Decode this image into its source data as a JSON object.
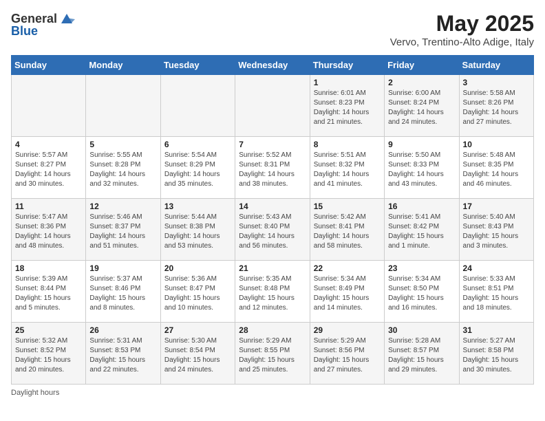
{
  "header": {
    "logo_general": "General",
    "logo_blue": "Blue",
    "month_year": "May 2025",
    "location": "Vervo, Trentino-Alto Adige, Italy"
  },
  "days_of_week": [
    "Sunday",
    "Monday",
    "Tuesday",
    "Wednesday",
    "Thursday",
    "Friday",
    "Saturday"
  ],
  "weeks": [
    [
      {
        "day": "",
        "info": ""
      },
      {
        "day": "",
        "info": ""
      },
      {
        "day": "",
        "info": ""
      },
      {
        "day": "",
        "info": ""
      },
      {
        "day": "1",
        "info": "Sunrise: 6:01 AM\nSunset: 8:23 PM\nDaylight: 14 hours\nand 21 minutes."
      },
      {
        "day": "2",
        "info": "Sunrise: 6:00 AM\nSunset: 8:24 PM\nDaylight: 14 hours\nand 24 minutes."
      },
      {
        "day": "3",
        "info": "Sunrise: 5:58 AM\nSunset: 8:26 PM\nDaylight: 14 hours\nand 27 minutes."
      }
    ],
    [
      {
        "day": "4",
        "info": "Sunrise: 5:57 AM\nSunset: 8:27 PM\nDaylight: 14 hours\nand 30 minutes."
      },
      {
        "day": "5",
        "info": "Sunrise: 5:55 AM\nSunset: 8:28 PM\nDaylight: 14 hours\nand 32 minutes."
      },
      {
        "day": "6",
        "info": "Sunrise: 5:54 AM\nSunset: 8:29 PM\nDaylight: 14 hours\nand 35 minutes."
      },
      {
        "day": "7",
        "info": "Sunrise: 5:52 AM\nSunset: 8:31 PM\nDaylight: 14 hours\nand 38 minutes."
      },
      {
        "day": "8",
        "info": "Sunrise: 5:51 AM\nSunset: 8:32 PM\nDaylight: 14 hours\nand 41 minutes."
      },
      {
        "day": "9",
        "info": "Sunrise: 5:50 AM\nSunset: 8:33 PM\nDaylight: 14 hours\nand 43 minutes."
      },
      {
        "day": "10",
        "info": "Sunrise: 5:48 AM\nSunset: 8:35 PM\nDaylight: 14 hours\nand 46 minutes."
      }
    ],
    [
      {
        "day": "11",
        "info": "Sunrise: 5:47 AM\nSunset: 8:36 PM\nDaylight: 14 hours\nand 48 minutes."
      },
      {
        "day": "12",
        "info": "Sunrise: 5:46 AM\nSunset: 8:37 PM\nDaylight: 14 hours\nand 51 minutes."
      },
      {
        "day": "13",
        "info": "Sunrise: 5:44 AM\nSunset: 8:38 PM\nDaylight: 14 hours\nand 53 minutes."
      },
      {
        "day": "14",
        "info": "Sunrise: 5:43 AM\nSunset: 8:40 PM\nDaylight: 14 hours\nand 56 minutes."
      },
      {
        "day": "15",
        "info": "Sunrise: 5:42 AM\nSunset: 8:41 PM\nDaylight: 14 hours\nand 58 minutes."
      },
      {
        "day": "16",
        "info": "Sunrise: 5:41 AM\nSunset: 8:42 PM\nDaylight: 15 hours\nand 1 minute."
      },
      {
        "day": "17",
        "info": "Sunrise: 5:40 AM\nSunset: 8:43 PM\nDaylight: 15 hours\nand 3 minutes."
      }
    ],
    [
      {
        "day": "18",
        "info": "Sunrise: 5:39 AM\nSunset: 8:44 PM\nDaylight: 15 hours\nand 5 minutes."
      },
      {
        "day": "19",
        "info": "Sunrise: 5:37 AM\nSunset: 8:46 PM\nDaylight: 15 hours\nand 8 minutes."
      },
      {
        "day": "20",
        "info": "Sunrise: 5:36 AM\nSunset: 8:47 PM\nDaylight: 15 hours\nand 10 minutes."
      },
      {
        "day": "21",
        "info": "Sunrise: 5:35 AM\nSunset: 8:48 PM\nDaylight: 15 hours\nand 12 minutes."
      },
      {
        "day": "22",
        "info": "Sunrise: 5:34 AM\nSunset: 8:49 PM\nDaylight: 15 hours\nand 14 minutes."
      },
      {
        "day": "23",
        "info": "Sunrise: 5:34 AM\nSunset: 8:50 PM\nDaylight: 15 hours\nand 16 minutes."
      },
      {
        "day": "24",
        "info": "Sunrise: 5:33 AM\nSunset: 8:51 PM\nDaylight: 15 hours\nand 18 minutes."
      }
    ],
    [
      {
        "day": "25",
        "info": "Sunrise: 5:32 AM\nSunset: 8:52 PM\nDaylight: 15 hours\nand 20 minutes."
      },
      {
        "day": "26",
        "info": "Sunrise: 5:31 AM\nSunset: 8:53 PM\nDaylight: 15 hours\nand 22 minutes."
      },
      {
        "day": "27",
        "info": "Sunrise: 5:30 AM\nSunset: 8:54 PM\nDaylight: 15 hours\nand 24 minutes."
      },
      {
        "day": "28",
        "info": "Sunrise: 5:29 AM\nSunset: 8:55 PM\nDaylight: 15 hours\nand 25 minutes."
      },
      {
        "day": "29",
        "info": "Sunrise: 5:29 AM\nSunset: 8:56 PM\nDaylight: 15 hours\nand 27 minutes."
      },
      {
        "day": "30",
        "info": "Sunrise: 5:28 AM\nSunset: 8:57 PM\nDaylight: 15 hours\nand 29 minutes."
      },
      {
        "day": "31",
        "info": "Sunrise: 5:27 AM\nSunset: 8:58 PM\nDaylight: 15 hours\nand 30 minutes."
      }
    ]
  ],
  "footer": {
    "daylight_hours_label": "Daylight hours"
  }
}
